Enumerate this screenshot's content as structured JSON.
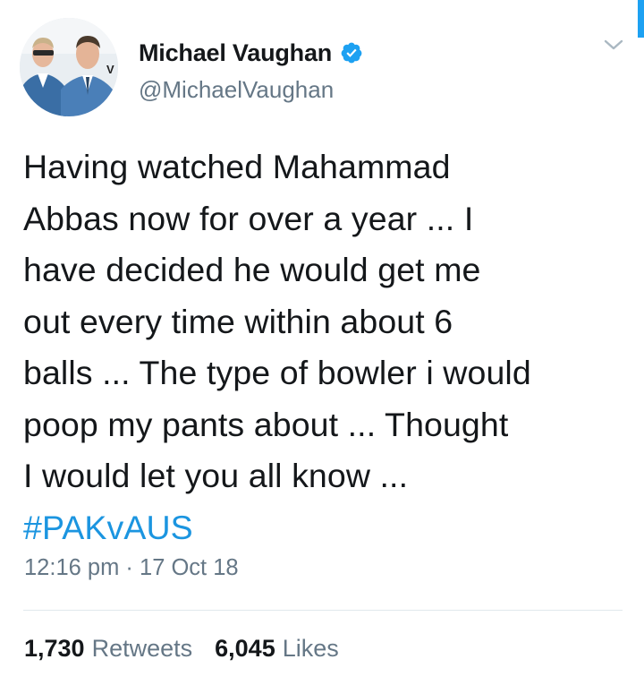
{
  "author": {
    "display_name": "Michael Vaughan",
    "handle": "@MichaelVaughan",
    "verified": true,
    "avatar_icon": "profile-photo-two-men-suits"
  },
  "tweet": {
    "lines": [
      "Having watched Mahammad",
      "Abbas now for over a year ... I",
      "have decided he would get me",
      "out every time within about 6",
      "balls ... The type of bowler i would",
      "poop my pants about ... Thought",
      "I would let you all know ..."
    ],
    "hashtag": "#PAKvAUS",
    "time": "12:16 pm",
    "separator": "·",
    "date": "17 Oct 18"
  },
  "stats": {
    "retweets_count": "1,730",
    "retweets_label": "Retweets",
    "likes_count": "6,045",
    "likes_label": "Likes"
  },
  "colors": {
    "accent": "#1da1f2",
    "hashtag": "#1b95e0",
    "text_primary": "#14171a",
    "text_secondary": "#657786",
    "divider": "#e1e8ed"
  }
}
